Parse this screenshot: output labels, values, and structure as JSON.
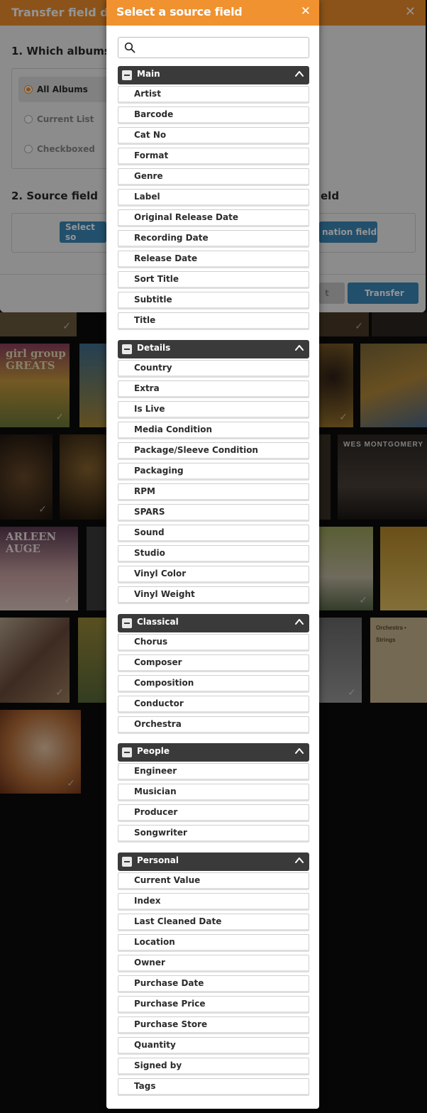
{
  "background_dialog": {
    "title": "Transfer field da",
    "close_glyph": "✕",
    "section1_title": "1. Which albums",
    "radio_options": [
      "All Albums",
      "Current List",
      "Checkboxed"
    ],
    "section2_title": "2. Source field",
    "section3_fragment": "eld",
    "select_source_button": "Select so",
    "destination_button": "nation field",
    "cancel_fragment": "t",
    "transfer_button": "Transfer",
    "accent_color": "#f0902c",
    "button_color": "#3c88b8"
  },
  "background_albums": {
    "cover_girl_group": "girl group\nGREATS",
    "cover_montgomery": "WES MONTGOMERY",
    "cover_arleen": "ARLEEN\nAUGE",
    "cover_mini_text": "Orchestra • Strings"
  },
  "popup": {
    "title": "Select a source field",
    "close_glyph": "✕",
    "search_placeholder": "",
    "header_color": "#f0922f",
    "groups": [
      {
        "label": "Main",
        "fields": [
          "Artist",
          "Barcode",
          "Cat No",
          "Format",
          "Genre",
          "Label",
          "Original Release Date",
          "Recording Date",
          "Release Date",
          "Sort Title",
          "Subtitle",
          "Title"
        ]
      },
      {
        "label": "Details",
        "fields": [
          "Country",
          "Extra",
          "Is Live",
          "Media Condition",
          "Package/Sleeve Condition",
          "Packaging",
          "RPM",
          "SPARS",
          "Sound",
          "Studio",
          "Vinyl Color",
          "Vinyl Weight"
        ]
      },
      {
        "label": "Classical",
        "fields": [
          "Chorus",
          "Composer",
          "Composition",
          "Conductor",
          "Orchestra"
        ]
      },
      {
        "label": "People",
        "fields": [
          "Engineer",
          "Musician",
          "Producer",
          "Songwriter"
        ]
      },
      {
        "label": "Personal",
        "fields": [
          "Current Value",
          "Index",
          "Last Cleaned Date",
          "Location",
          "Owner",
          "Purchase Date",
          "Purchase Price",
          "Purchase Store",
          "Quantity",
          "Signed by",
          "Tags"
        ]
      }
    ]
  }
}
